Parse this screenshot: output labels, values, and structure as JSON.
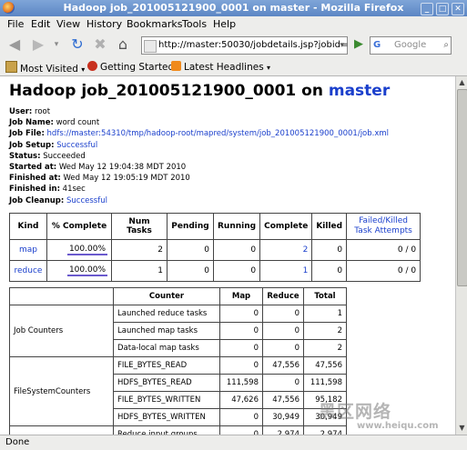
{
  "window": {
    "title": "Hadoop job_201005121900_0001 on master - Mozilla Firefox"
  },
  "menu": {
    "file": "File",
    "edit": "Edit",
    "view": "View",
    "history": "History",
    "bookmarks": "Bookmarks",
    "tools": "Tools",
    "help": "Help"
  },
  "navbar": {
    "url": "http://master:50030/jobdetails.jsp?jobid=",
    "search_engine_letter": "G",
    "search_placeholder": "Google"
  },
  "bookmarks_bar": {
    "most_visited": "Most Visited",
    "getting_started": "Getting Started",
    "latest_headlines": "Latest Headlines"
  },
  "page": {
    "title_prefix": "Hadoop job_201005121900_0001 on ",
    "title_host": "master",
    "info": {
      "user_label": "User:",
      "user": "root",
      "job_name_label": "Job Name:",
      "job_name": "word count",
      "job_file_label": "Job File:",
      "job_file": "hdfs://master:54310/tmp/hadoop-root/mapred/system/job_201005121900_0001/job.xml",
      "job_setup_label": "Job Setup:",
      "job_setup": "Successful",
      "status_label": "Status:",
      "status": "Succeeded",
      "started_at_label": "Started at:",
      "started_at": "Wed May 12 19:04:38 MDT 2010",
      "finished_at_label": "Finished at:",
      "finished_at": "Wed May 12 19:05:19 MDT 2010",
      "finished_in_label": "Finished in:",
      "finished_in": "41sec",
      "job_cleanup_label": "Job Cleanup:",
      "job_cleanup": "Successful"
    },
    "jobs_table": {
      "headers": {
        "kind": "Kind",
        "pct_complete": "% Complete",
        "num_tasks": "Num Tasks",
        "pending": "Pending",
        "running": "Running",
        "complete": "Complete",
        "killed": "Killed",
        "failed_killed_line1": "Failed/Killed",
        "failed_killed_line2": "Task Attempts"
      },
      "rows": [
        {
          "kind": "map",
          "pct": "100.00%",
          "pct_value": 100,
          "num_tasks": "2",
          "pending": "0",
          "running": "0",
          "complete": "2",
          "killed": "0",
          "failed_killed": "0 / 0"
        },
        {
          "kind": "reduce",
          "pct": "100.00%",
          "pct_value": 100,
          "num_tasks": "1",
          "pending": "0",
          "running": "0",
          "complete": "1",
          "killed": "0",
          "failed_killed": "0 / 0"
        }
      ]
    },
    "counters_table": {
      "headers": {
        "group": "",
        "counter": "Counter",
        "map": "Map",
        "reduce": "Reduce",
        "total": "Total"
      },
      "groups": [
        {
          "name": "Job Counters",
          "rows": [
            {
              "counter": "Launched reduce tasks",
              "map": "0",
              "reduce": "0",
              "total": "1"
            },
            {
              "counter": "Launched map tasks",
              "map": "0",
              "reduce": "0",
              "total": "2"
            },
            {
              "counter": "Data-local map tasks",
              "map": "0",
              "reduce": "0",
              "total": "2"
            }
          ]
        },
        {
          "name": "FileSystemCounters",
          "rows": [
            {
              "counter": "FILE_BYTES_READ",
              "map": "0",
              "reduce": "47,556",
              "total": "47,556"
            },
            {
              "counter": "HDFS_BYTES_READ",
              "map": "111,598",
              "reduce": "0",
              "total": "111,598"
            },
            {
              "counter": "FILE_BYTES_WRITTEN",
              "map": "47,626",
              "reduce": "47,556",
              "total": "95,182"
            },
            {
              "counter": "HDFS_BYTES_WRITTEN",
              "map": "0",
              "reduce": "30,949",
              "total": "30,949"
            }
          ]
        },
        {
          "name": "",
          "rows": [
            {
              "counter": "Reduce input groups",
              "map": "0",
              "reduce": "2,974",
              "total": "2,974"
            }
          ]
        }
      ]
    }
  },
  "watermark": {
    "big": "黑区网络",
    "small": "www.heiqu.com"
  },
  "status_bar": {
    "text": "Done"
  }
}
